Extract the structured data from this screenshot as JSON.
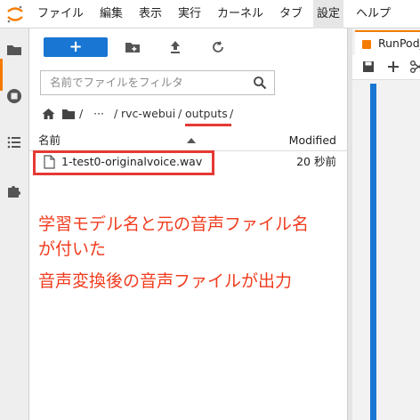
{
  "menubar": {
    "items": [
      "ファイル",
      "編集",
      "表示",
      "実行",
      "カーネル",
      "タブ",
      "設定",
      "ヘルプ"
    ],
    "active_index": 6
  },
  "activity_bar": {
    "icons": [
      "folder-icon",
      "running-icon",
      "commands-icon",
      "extensions-icon"
    ]
  },
  "file_browser": {
    "toolbar": {
      "new_launcher_label": "+",
      "icons": [
        "new-folder-icon",
        "upload-icon",
        "refresh-icon"
      ]
    },
    "search": {
      "placeholder": "名前でファイルをフィルタ"
    },
    "breadcrumbs": {
      "separator1": "/",
      "ellipsis": "···",
      "separator2": "/",
      "crumb1": "rvc-webui",
      "separator3": "/",
      "crumb2": "outputs",
      "separator4": "/"
    },
    "columns": {
      "name": "名前",
      "modified": "Modified"
    },
    "files": [
      {
        "name": "1-test0-originalvoice.wav",
        "modified": "20 秒前"
      }
    ]
  },
  "annotation": {
    "line1": "学習モデル名と元の音声ファイル名",
    "line2": "が付いた",
    "line3": "音声変換後の音声ファイルが出力"
  },
  "notebook": {
    "tab_label": "RunPod_"
  },
  "colors": {
    "accent": "#1976d2",
    "highlight": "#e53935",
    "annotation_text": "#f03c1e",
    "brand": "#f57c00"
  }
}
